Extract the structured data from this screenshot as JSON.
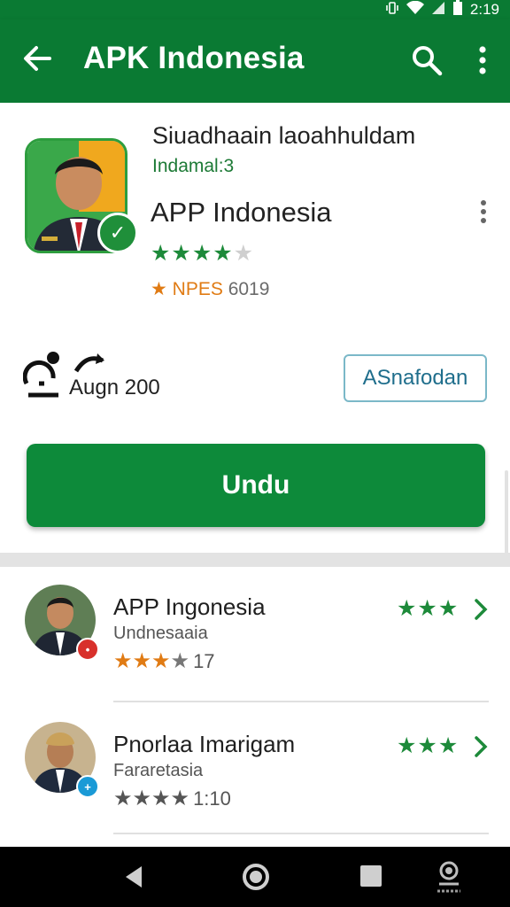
{
  "status_bar": {
    "time": "2:19",
    "icons": [
      "vibrate-icon",
      "wifi-icon",
      "signal-icon",
      "battery-icon"
    ]
  },
  "app_bar": {
    "title": "APK Indonesia",
    "icons": [
      "back-arrow-icon",
      "search-icon",
      "more-vert-icon"
    ]
  },
  "detail": {
    "headline": "Siuadhaain laoahhuldam",
    "subline": "Indamal:3",
    "app_name": "APP Indonesia",
    "rating_stars": 4.5,
    "rating_label": "NPES",
    "rating_number": "6019",
    "stat_text": "Augn 200",
    "outline_button": "ASnafodan",
    "download_button": "Undu"
  },
  "list": {
    "rows": [
      {
        "name": "APP Ingonesia",
        "sub": "Undnesaaia",
        "rating": 3,
        "count": "17",
        "right_stars": 3,
        "badge_color": "#d8302b"
      },
      {
        "name": "Pnorlaa Imarigam",
        "sub": "Fararetasia",
        "rating": 4,
        "count": "1:10",
        "right_stars": 3,
        "badge_color": "#1a9ad6"
      }
    ]
  },
  "colors": {
    "brand_green": "#0a7a33",
    "button_green": "#0d8a3a",
    "star_green": "#1d8a3a",
    "star_orange": "#e07b14"
  }
}
